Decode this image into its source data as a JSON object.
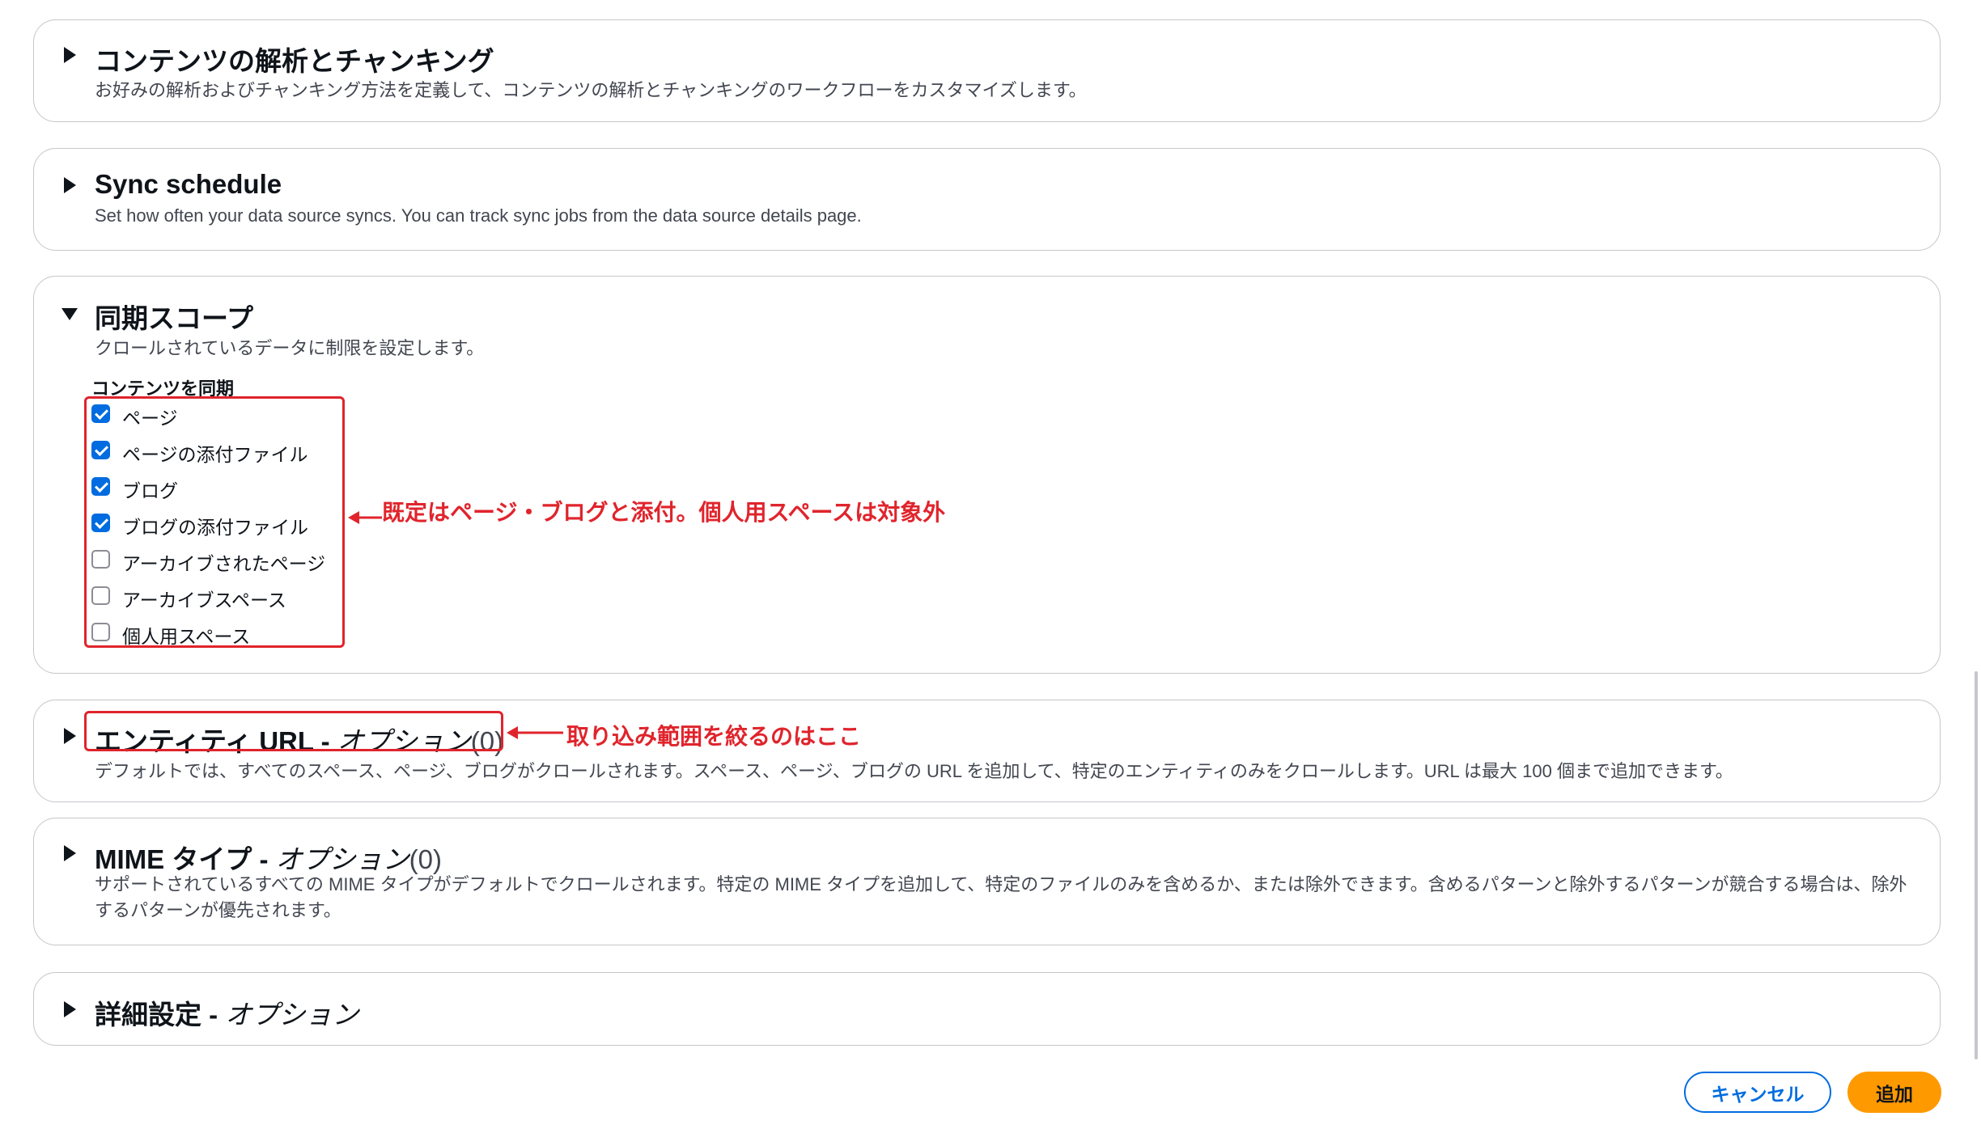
{
  "sections": {
    "parsing": {
      "title": "コンテンツの解析とチャンキング",
      "description": "お好みの解析およびチャンキング方法を定義して、コンテンツの解析とチャンキングのワークフローをカスタマイズします。"
    },
    "sync_schedule": {
      "title": "Sync schedule",
      "description": "Set how often your data source syncs. You can track sync jobs from the data source details page."
    },
    "sync_scope": {
      "title": "同期スコープ",
      "description": "クロールされているデータに制限を設定します。",
      "field_label": "コンテンツを同期",
      "options": [
        {
          "label": "ページ",
          "checked": true
        },
        {
          "label": "ページの添付ファイル",
          "checked": true
        },
        {
          "label": "ブログ",
          "checked": true
        },
        {
          "label": "ブログの添付ファイル",
          "checked": true
        },
        {
          "label": "アーカイブされたページ",
          "checked": false
        },
        {
          "label": "アーカイブスペース",
          "checked": false
        },
        {
          "label": "個人用スペース",
          "checked": false
        }
      ]
    },
    "entity_url": {
      "title": "エンティティ URL - ",
      "optional": "オプション",
      "count": "(0)",
      "description": "デフォルトでは、すべてのスペース、ページ、ブログがクロールされます。スペース、ページ、ブログの URL を追加して、特定のエンティティのみをクロールします。URL は最大 100 個まで追加できます。"
    },
    "mime_type": {
      "title": "MIME タイプ - ",
      "optional": "オプション",
      "count": "(0)",
      "description": "サポートされているすべての MIME タイプがデフォルトでクロールされます。特定の MIME タイプを追加して、特定のファイルのみを含めるか、または除外できます。含めるパターンと除外するパターンが競合する場合は、除外するパターンが優先されます。"
    },
    "advanced": {
      "title": "詳細設定 - ",
      "optional": "オプション"
    }
  },
  "annotations": {
    "scope_note": "既定はページ・ブログと添付。個人用スペースは対象外",
    "entity_note": "取り込み範囲を絞るのはここ",
    "color": "#e0242c"
  },
  "buttons": {
    "cancel": "キャンセル",
    "add": "追加"
  },
  "colors": {
    "primary": "#006ce0",
    "accent": "#ff9900"
  }
}
